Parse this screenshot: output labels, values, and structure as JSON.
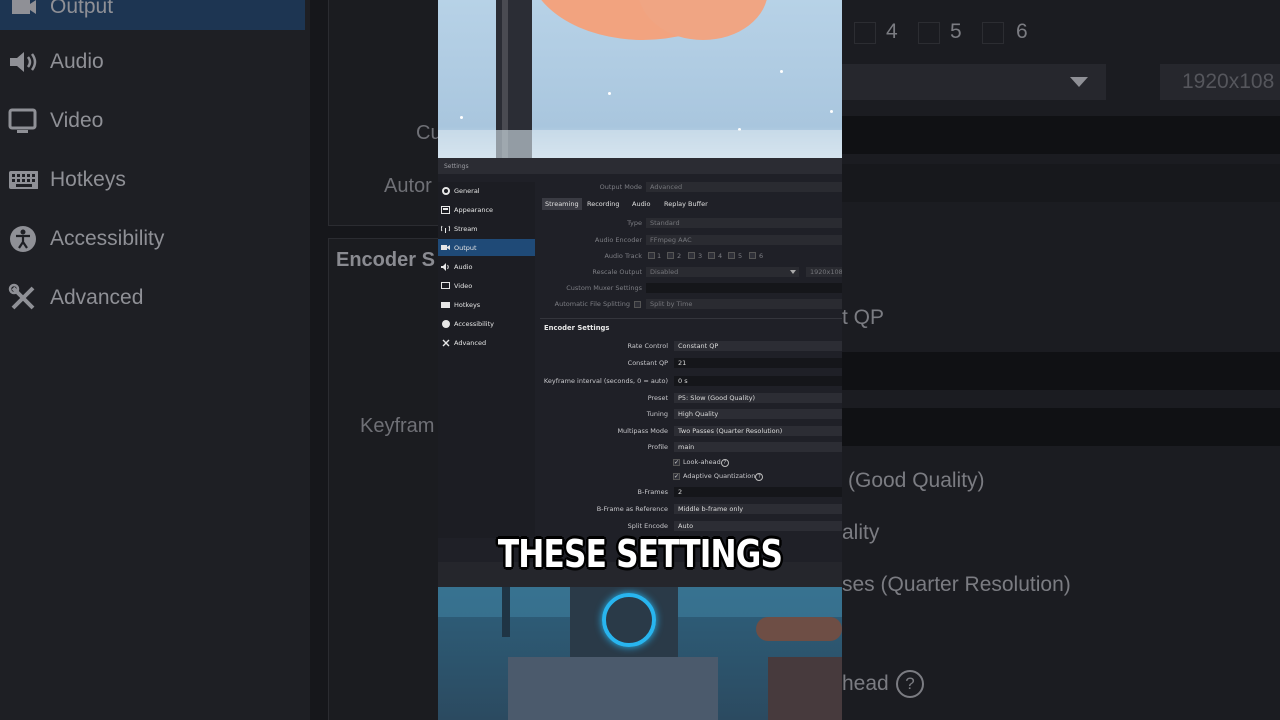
{
  "background_left": {
    "sidebar_items": [
      {
        "label": "Output",
        "icon": "output-icon"
      },
      {
        "label": "Audio",
        "icon": "audio-icon"
      },
      {
        "label": "Video",
        "icon": "video-icon"
      },
      {
        "label": "Hotkeys",
        "icon": "keyboard-icon"
      },
      {
        "label": "Accessibility",
        "icon": "accessibility-icon"
      },
      {
        "label": "Advanced",
        "icon": "wrench-icon"
      }
    ],
    "cut_labels": {
      "custom": "Cu",
      "auto": "Autor",
      "encoder": "Encoder S",
      "keyframe": "Keyfram"
    }
  },
  "background_right": {
    "track_numbers": [
      "4",
      "5",
      "6"
    ],
    "rescale_value": "1920x108",
    "cut_values": {
      "rate": "t QP",
      "preset": "(Good Quality)",
      "tuning": "ality",
      "multipass": "ses (Quarter Resolution)",
      "lookahead": "head"
    }
  },
  "settings": {
    "window_title": "Settings",
    "sidebar": [
      {
        "label": "General",
        "icon": "gear-icon"
      },
      {
        "label": "Appearance",
        "icon": "palette-icon"
      },
      {
        "label": "Stream",
        "icon": "antenna-icon"
      },
      {
        "label": "Output",
        "icon": "output-icon",
        "active": true
      },
      {
        "label": "Audio",
        "icon": "speaker-icon"
      },
      {
        "label": "Video",
        "icon": "monitor-icon"
      },
      {
        "label": "Hotkeys",
        "icon": "keyboard-icon"
      },
      {
        "label": "Accessibility",
        "icon": "accessibility-icon"
      },
      {
        "label": "Advanced",
        "icon": "wrench-icon"
      }
    ],
    "output_mode": {
      "label": "Output Mode",
      "value": "Advanced"
    },
    "tabs": [
      "Streaming",
      "Recording",
      "Audio",
      "Replay Buffer"
    ],
    "active_tab": "Recording",
    "type": {
      "label": "Type",
      "value": "Standard"
    },
    "audio_encoder": {
      "label": "Audio Encoder",
      "value": "FFmpeg AAC"
    },
    "audio_track": {
      "label": "Audio Track",
      "tracks": [
        "1",
        "2",
        "3",
        "4",
        "5",
        "6"
      ]
    },
    "rescale_output": {
      "label": "Rescale Output",
      "value": "Disabled",
      "resolution": "1920x108"
    },
    "custom_muxer": {
      "label": "Custom Muxer Settings",
      "value": ""
    },
    "auto_split": {
      "label": "Automatic File Splitting",
      "value": "Split by Time"
    },
    "encoder_title": "Encoder Settings",
    "encoder": {
      "rate_control": {
        "label": "Rate Control",
        "value": "Constant QP"
      },
      "constant_qp": {
        "label": "Constant QP",
        "value": "21"
      },
      "keyframe": {
        "label": "Keyframe interval (seconds, 0 = auto)",
        "value": "0 s"
      },
      "preset": {
        "label": "Preset",
        "value": "P5: Slow (Good Quality)"
      },
      "tuning": {
        "label": "Tuning",
        "value": "High Quality"
      },
      "multipass": {
        "label": "Multipass Mode",
        "value": "Two Passes (Quarter Resolution)"
      },
      "profile": {
        "label": "Profile",
        "value": "main"
      },
      "lookahead": {
        "label": "Look-ahead",
        "checked": true
      },
      "adaptive_quant": {
        "label": "Adaptive Quantization",
        "checked": true
      },
      "bframes": {
        "label": "B-Frames",
        "value": "2"
      },
      "bframe_ref": {
        "label": "B-Frame as Reference",
        "value": "Middle b-frame only"
      },
      "split_encode": {
        "label": "Split Encode",
        "value": "Auto"
      }
    }
  },
  "caption": "THESE SETTINGS"
}
